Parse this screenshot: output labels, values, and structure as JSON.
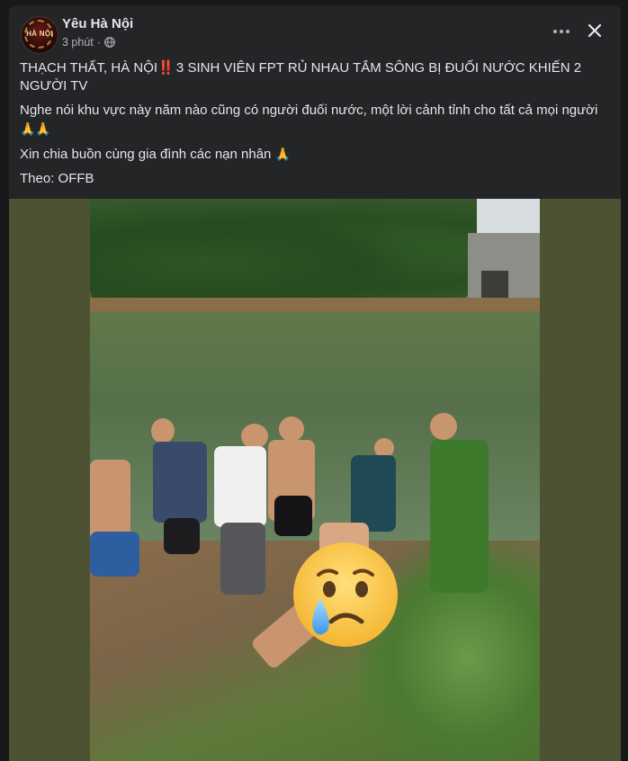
{
  "post": {
    "author": "Yêu Hà Nội",
    "avatar_text": "HÀ NỘI",
    "time": "3 phút",
    "separator": "·"
  },
  "content": {
    "headline_prefix": "THẠCH THẤT, HÀ NỘI",
    "headline_bang": "‼️",
    "headline_rest": " 3 SINH VIÊN FPT RỦ NHAU TẮM SÔNG BỊ ĐUỐI NƯỚC KHIẾN 2 NGƯỜI TV",
    "line2": "Nghe nói khu vực này năm nào cũng có người đuối nước, một lời cảnh tỉnh cho tất cả mọi người",
    "line2_emoji": "🙏🙏",
    "line3": "Xin chia buồn cùng gia đình các nạn nhân",
    "line3_emoji": "🙏",
    "source": "Theo: OFFB"
  },
  "icons": {
    "globe": "globe-icon",
    "more": "more-options-icon",
    "close": "close-icon",
    "crying_emoji": "crying-face-emoji"
  },
  "colors": {
    "card_bg": "#242526",
    "page_bg": "#18191a",
    "text_primary": "#e4e6eb",
    "text_secondary": "#b0b3b8",
    "photo_frame": "#4d5232"
  }
}
